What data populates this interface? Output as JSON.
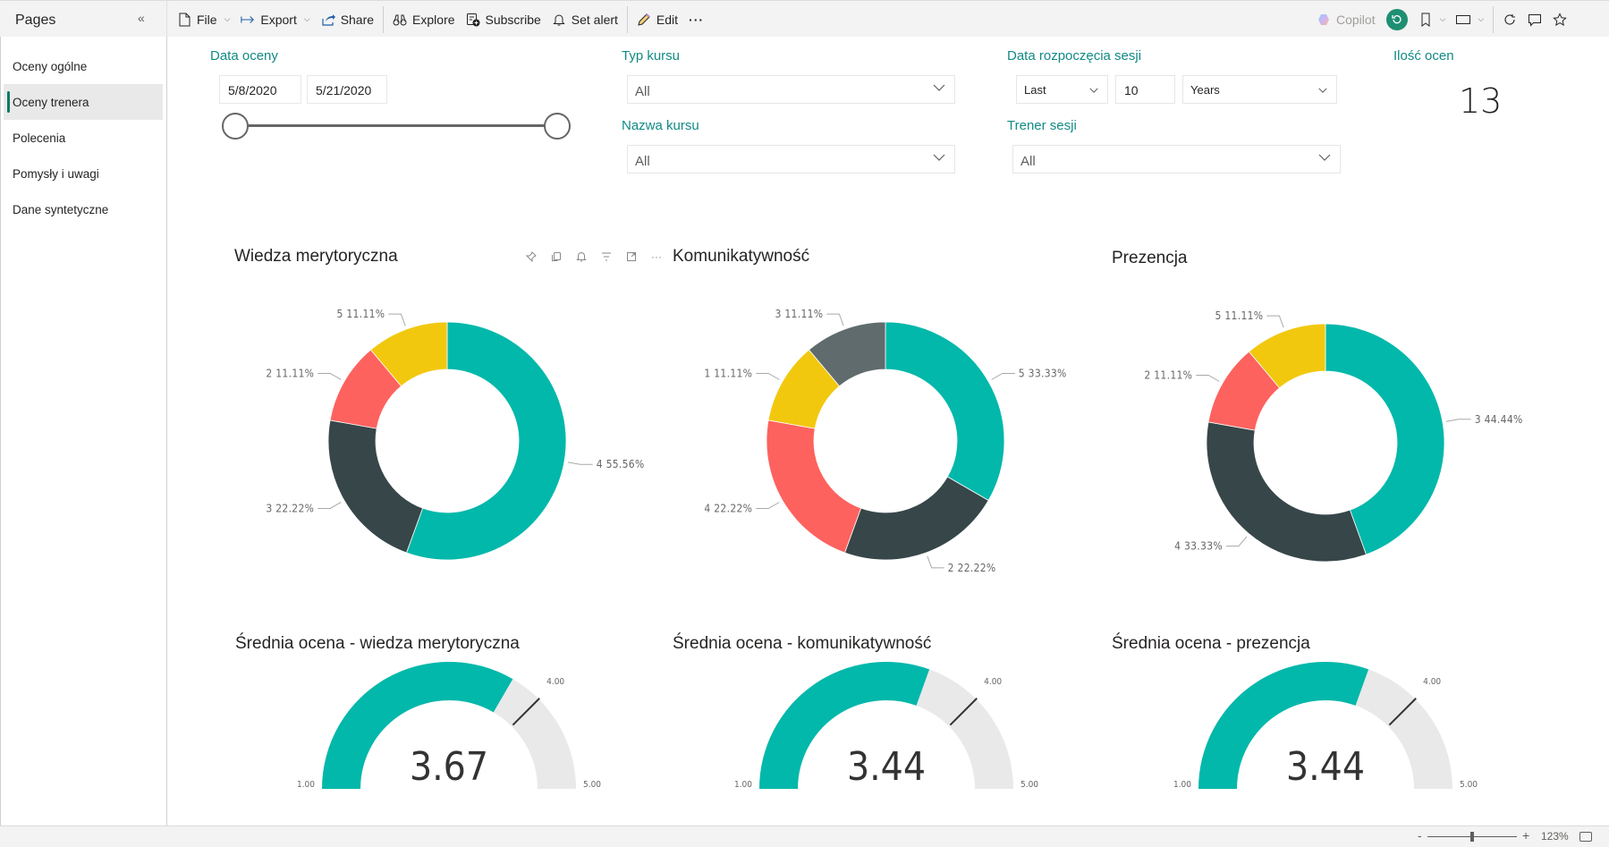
{
  "toolbar": {
    "pages_label": "Pages",
    "collapse_icon": "double-chevron-left-icon",
    "file_label": "File",
    "export_label": "Export",
    "share_label": "Share",
    "explore_label": "Explore",
    "subscribe_label": "Subscribe",
    "set_alert_label": "Set alert",
    "edit_label": "Edit",
    "more_label": "···",
    "copilot_label": "Copilot"
  },
  "sidebar": {
    "items": [
      {
        "label": "Oceny ogólne",
        "active": false
      },
      {
        "label": "Oceny trenera",
        "active": true
      },
      {
        "label": "Polecenia",
        "active": false
      },
      {
        "label": "Pomysły i uwagi",
        "active": false
      },
      {
        "label": "Dane syntetyczne",
        "active": false
      }
    ]
  },
  "filters": {
    "data_oceny": {
      "title": "Data oceny",
      "start": "5/8/2020",
      "end": "5/21/2020",
      "range_fraction": [
        0,
        1
      ]
    },
    "typ_kursu": {
      "title": "Typ kursu",
      "value": "All"
    },
    "nazwa_kursu": {
      "title": "Nazwa kursu",
      "value": "All"
    },
    "data_rozpoczecia": {
      "title": "Data rozpoczęcia sesji",
      "mode": "Last",
      "count": "10",
      "unit": "Years"
    },
    "trener_sesji": {
      "title": "Trener sesji",
      "value": "All"
    }
  },
  "kpi": {
    "title": "Ilość ocen",
    "value": "13"
  },
  "colors": {
    "teal": "#01B8AA",
    "dark": "#374649",
    "red": "#FD625E",
    "yellow": "#F2C80F",
    "gray": "#5F6B6D",
    "gauge_bg": "#E9E9E9",
    "accent_title": "#118A85"
  },
  "chart_data": [
    {
      "type": "pie",
      "variant": "donut",
      "title": "Wiedza merytoryczna",
      "slices": [
        {
          "label": "4",
          "value": 55.56,
          "color": "#01B8AA"
        },
        {
          "label": "3",
          "value": 22.22,
          "color": "#374649"
        },
        {
          "label": "2",
          "value": 11.11,
          "color": "#FD625E"
        },
        {
          "label": "5",
          "value": 11.11,
          "color": "#F2C80F"
        }
      ]
    },
    {
      "type": "pie",
      "variant": "donut",
      "title": "Komunikatywność",
      "slices": [
        {
          "label": "5",
          "value": 33.33,
          "color": "#01B8AA"
        },
        {
          "label": "2",
          "value": 22.22,
          "color": "#374649"
        },
        {
          "label": "4",
          "value": 22.22,
          "color": "#FD625E"
        },
        {
          "label": "1",
          "value": 11.11,
          "color": "#F2C80F"
        },
        {
          "label": "3",
          "value": 11.11,
          "color": "#5F6B6D"
        }
      ]
    },
    {
      "type": "pie",
      "variant": "donut",
      "title": "Prezencja",
      "slices": [
        {
          "label": "3",
          "value": 44.44,
          "color": "#01B8AA"
        },
        {
          "label": "4",
          "value": 33.33,
          "color": "#374649"
        },
        {
          "label": "2",
          "value": 11.11,
          "color": "#FD625E"
        },
        {
          "label": "5",
          "value": 11.11,
          "color": "#F2C80F"
        }
      ]
    },
    {
      "type": "gauge",
      "title": "Średnia ocena - wiedza merytoryczna",
      "value": 3.67,
      "value_label": "3.67",
      "min": 1,
      "max": 5,
      "target": 4,
      "min_label": "1.00",
      "max_label": "5.00",
      "target_label": "4.00"
    },
    {
      "type": "gauge",
      "title": "Średnia ocena - komunikatywność",
      "value": 3.44,
      "value_label": "3.44",
      "min": 1,
      "max": 5,
      "target": 4,
      "min_label": "1.00",
      "max_label": "5.00",
      "target_label": "4.00"
    },
    {
      "type": "gauge",
      "title": "Średnia ocena - prezencja",
      "value": 3.44,
      "value_label": "3.44",
      "min": 1,
      "max": 5,
      "target": 4,
      "min_label": "1.00",
      "max_label": "5.00",
      "target_label": "4.00"
    }
  ],
  "statusbar": {
    "zoom_minus": "-",
    "zoom_plus": "+",
    "zoom_level": "123%",
    "zoom_fraction": 0.5
  }
}
